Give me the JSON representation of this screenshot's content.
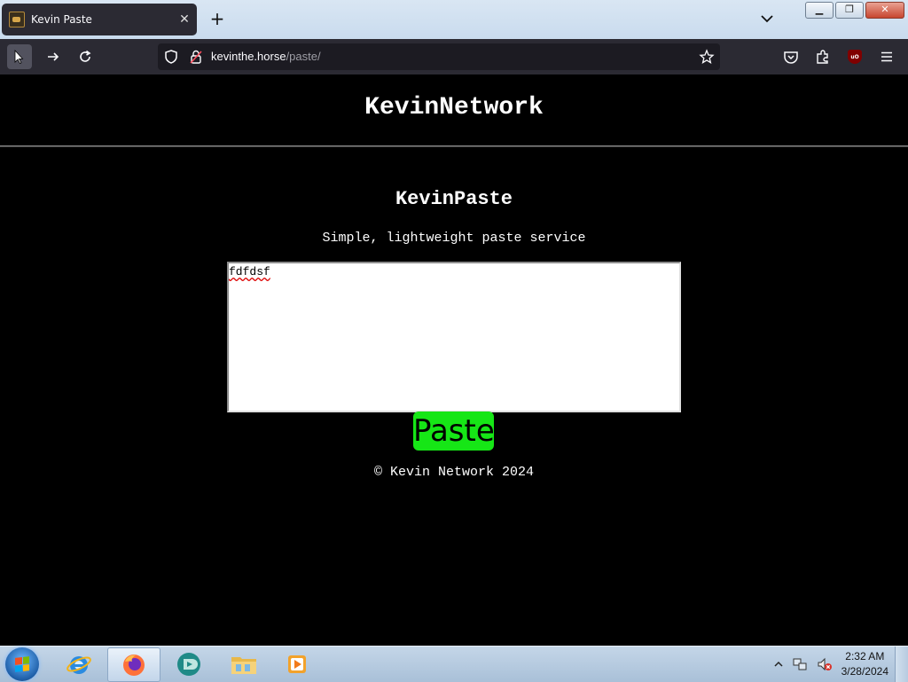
{
  "browser": {
    "tab_title": "Kevin Paste",
    "url_host": "kevinthe.horse",
    "url_path": "/paste/"
  },
  "page": {
    "site_title": "KevinNetwork",
    "app_title": "KevinPaste",
    "tagline": "Simple, lightweight paste service",
    "textarea_value": "fdfdsf",
    "paste_button": "Paste",
    "footer": "© Kevin Network 2024"
  },
  "taskbar": {
    "time": "2:32 AM",
    "date": "3/28/2024",
    "pinned": [
      "internet-explorer-icon",
      "firefox-icon",
      "app-icon",
      "file-explorer-icon",
      "media-player-icon"
    ]
  },
  "colors": {
    "page_bg": "#000000",
    "button_green": "#16e616",
    "browser_chrome": "#2b2a33"
  }
}
